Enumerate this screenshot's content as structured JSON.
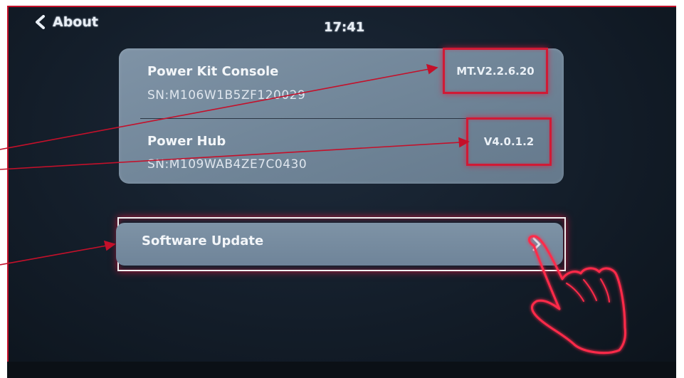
{
  "header": {
    "back_label": "About",
    "time": "17:41"
  },
  "devices": [
    {
      "name": "Power Kit Console",
      "serial": "SN:M106W1B5ZF120029",
      "version": "MT.V2.2.6.20"
    },
    {
      "name": "Power Hub",
      "serial": "SN:M109WAB4ZE7C0430",
      "version": "V4.0.1.2"
    }
  ],
  "actions": {
    "software_update_label": "Software Update"
  },
  "colors": {
    "annotation_red": "#c4102a",
    "card_bg": "#7589a0",
    "screen_bg": "#131d29"
  },
  "icons": {
    "back": "chevron-left-icon",
    "update_arrow": "chevron-right-icon",
    "pointer": "hand-pointer-icon"
  }
}
